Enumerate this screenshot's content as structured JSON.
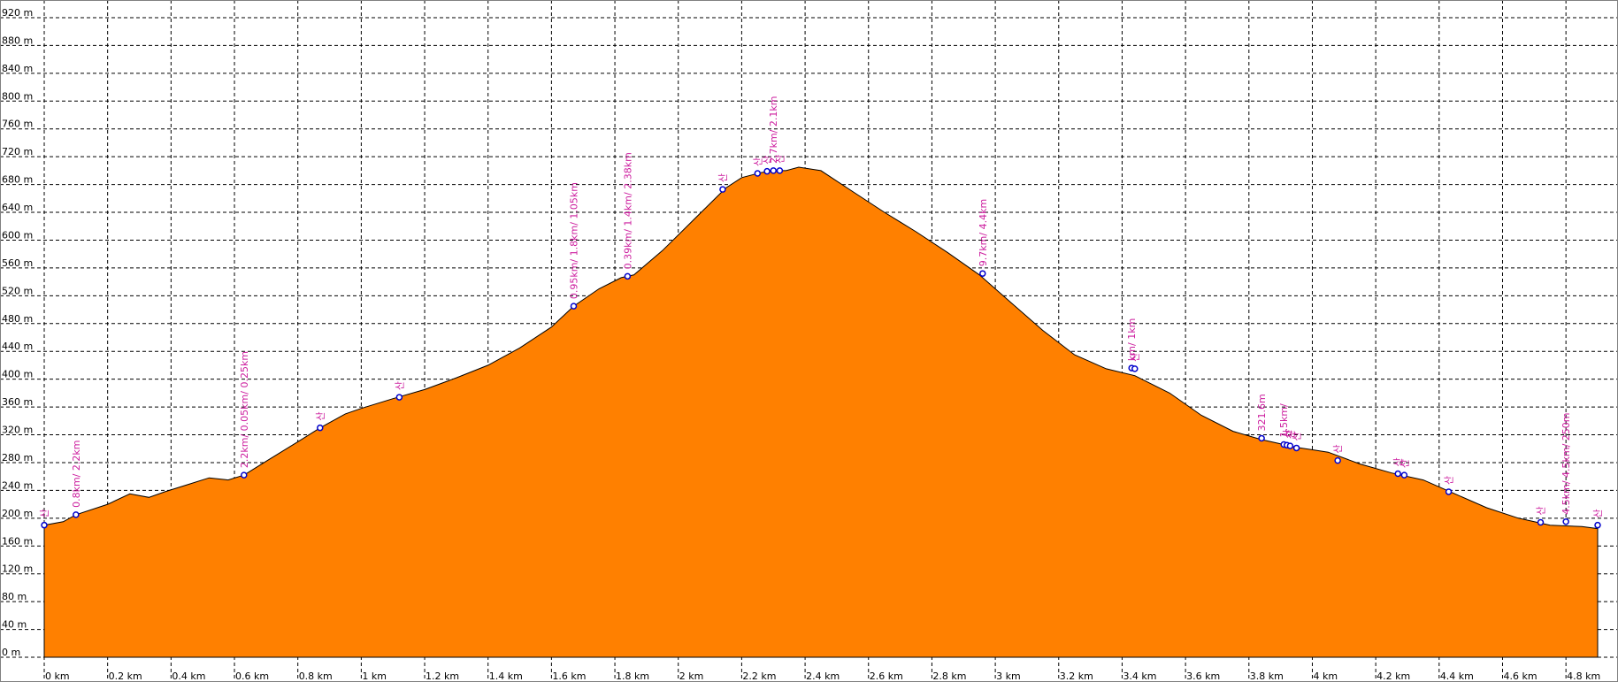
{
  "colors": {
    "profile_fill": "#ff8000",
    "profile_stroke": "#000000",
    "waypoint": "#0000cc",
    "label": "#cc1c9e",
    "grid": "#000000",
    "background": "#ffffff"
  },
  "chart_data": {
    "type": "area",
    "title": "",
    "xlabel": "",
    "ylabel": "",
    "xlim": [
      0,
      4.9
    ],
    "ylim": [
      0,
      920
    ],
    "grid": true,
    "x_ticks": [
      0,
      0.2,
      0.4,
      0.6,
      0.8,
      1.0,
      1.2,
      1.4,
      1.6,
      1.8,
      2.0,
      2.2,
      2.4,
      2.6,
      2.8,
      3.0,
      3.2,
      3.4,
      3.6,
      3.8,
      4.0,
      4.2,
      4.4,
      4.6,
      4.8
    ],
    "x_tick_labels": [
      "0 km",
      "0.2 km",
      "0.4 km",
      "0.6 km",
      "0.8 km",
      "1 km",
      "1.2 km",
      "1.4 km",
      "1.6 km",
      "1.8 km",
      "2 km",
      "2.2 km",
      "2.4 km",
      "2.6 km",
      "2.8 km",
      "3 km",
      "3.2 km",
      "3.4 km",
      "3.6 km",
      "3.8 km",
      "4 km",
      "4.2 km",
      "4.4 km",
      "4.6 km",
      "4.8 km"
    ],
    "y_ticks": [
      0,
      40,
      80,
      120,
      160,
      200,
      240,
      280,
      320,
      360,
      400,
      440,
      480,
      520,
      560,
      600,
      640,
      680,
      720,
      760,
      800,
      840,
      880,
      920
    ],
    "y_tick_labels": [
      "0 m",
      "40 m",
      "80 m",
      "120 m",
      "160 m",
      "200 m",
      "240 m",
      "280 m",
      "320 m",
      "360 m",
      "400 m",
      "440 m",
      "480 m",
      "520 m",
      "560 m",
      "600 m",
      "640 m",
      "680 m",
      "720 m",
      "760 m",
      "800 m",
      "840 m",
      "880 m",
      "920 m"
    ],
    "series": [
      {
        "x": [
          0,
          0.06,
          0.1,
          0.2,
          0.27,
          0.33,
          0.38,
          0.45,
          0.52,
          0.58,
          0.63,
          0.7,
          0.8,
          0.87,
          0.95,
          1.0,
          1.1,
          1.2,
          1.3,
          1.4,
          1.5,
          1.6,
          1.67,
          1.75,
          1.82,
          1.86,
          1.95,
          2.05,
          2.15,
          2.2,
          2.26,
          2.3,
          2.34,
          2.38,
          2.45,
          2.55,
          2.65,
          2.75,
          2.85,
          2.95,
          3.05,
          3.15,
          3.25,
          3.35,
          3.44,
          3.55,
          3.65,
          3.75,
          3.84,
          3.95,
          4.05,
          4.15,
          4.25,
          4.35,
          4.45,
          4.55,
          4.65,
          4.75,
          4.85,
          4.9
        ],
        "y": [
          190,
          195,
          205,
          220,
          235,
          230,
          238,
          248,
          258,
          255,
          262,
          282,
          310,
          330,
          350,
          358,
          372,
          385,
          402,
          420,
          445,
          475,
          505,
          530,
          546,
          550,
          585,
          630,
          675,
          690,
          697,
          700,
          700,
          705,
          700,
          670,
          640,
          612,
          582,
          550,
          510,
          470,
          435,
          415,
          405,
          380,
          348,
          325,
          313,
          302,
          295,
          278,
          265,
          255,
          235,
          215,
          200,
          190,
          188,
          185
        ]
      }
    ],
    "waypoints": [
      {
        "x": 0.0,
        "y": 190,
        "label": "산"
      },
      {
        "x": 0.1,
        "y": 205,
        "label": "0.8km/ 2.2km"
      },
      {
        "x": 0.63,
        "y": 262,
        "label": "2.2km/ 0.05km/ 0.25km"
      },
      {
        "x": 0.87,
        "y": 330,
        "label": "산"
      },
      {
        "x": 1.12,
        "y": 374,
        "label": "산"
      },
      {
        "x": 1.67,
        "y": 505,
        "label": "0.95km/ 1.8km/ 1.05km"
      },
      {
        "x": 1.84,
        "y": 548,
        "label": "0.39km/ 1.4km/ 2.38km"
      },
      {
        "x": 2.14,
        "y": 673,
        "label": "산"
      },
      {
        "x": 2.25,
        "y": 696,
        "label": "산"
      },
      {
        "x": 2.28,
        "y": 699,
        "label": "산"
      },
      {
        "x": 2.3,
        "y": 700,
        "label": "2.7km/ 2.1km"
      },
      {
        "x": 2.32,
        "y": 700,
        "label": "산"
      },
      {
        "x": 2.96,
        "y": 552,
        "label": "9.7km/ 4.4km"
      },
      {
        "x": 3.43,
        "y": 416,
        "label": "km/ 1km"
      },
      {
        "x": 3.44,
        "y": 415,
        "label": "산"
      },
      {
        "x": 3.84,
        "y": 315,
        "label": "321.6m"
      },
      {
        "x": 3.91,
        "y": 306,
        "label": "1.5km/"
      },
      {
        "x": 3.92,
        "y": 305,
        "label": "산"
      },
      {
        "x": 3.93,
        "y": 304,
        "label": "산"
      },
      {
        "x": 3.95,
        "y": 301,
        "label": "산"
      },
      {
        "x": 4.08,
        "y": 283,
        "label": "산"
      },
      {
        "x": 4.27,
        "y": 264,
        "label": "산"
      },
      {
        "x": 4.29,
        "y": 262,
        "label": "산"
      },
      {
        "x": 4.43,
        "y": 238,
        "label": "산"
      },
      {
        "x": 4.72,
        "y": 194,
        "label": "산"
      },
      {
        "x": 4.8,
        "y": 195,
        "label": "4.5km/ 4.5km/ 250m"
      },
      {
        "x": 4.9,
        "y": 190,
        "label": "산"
      }
    ]
  }
}
